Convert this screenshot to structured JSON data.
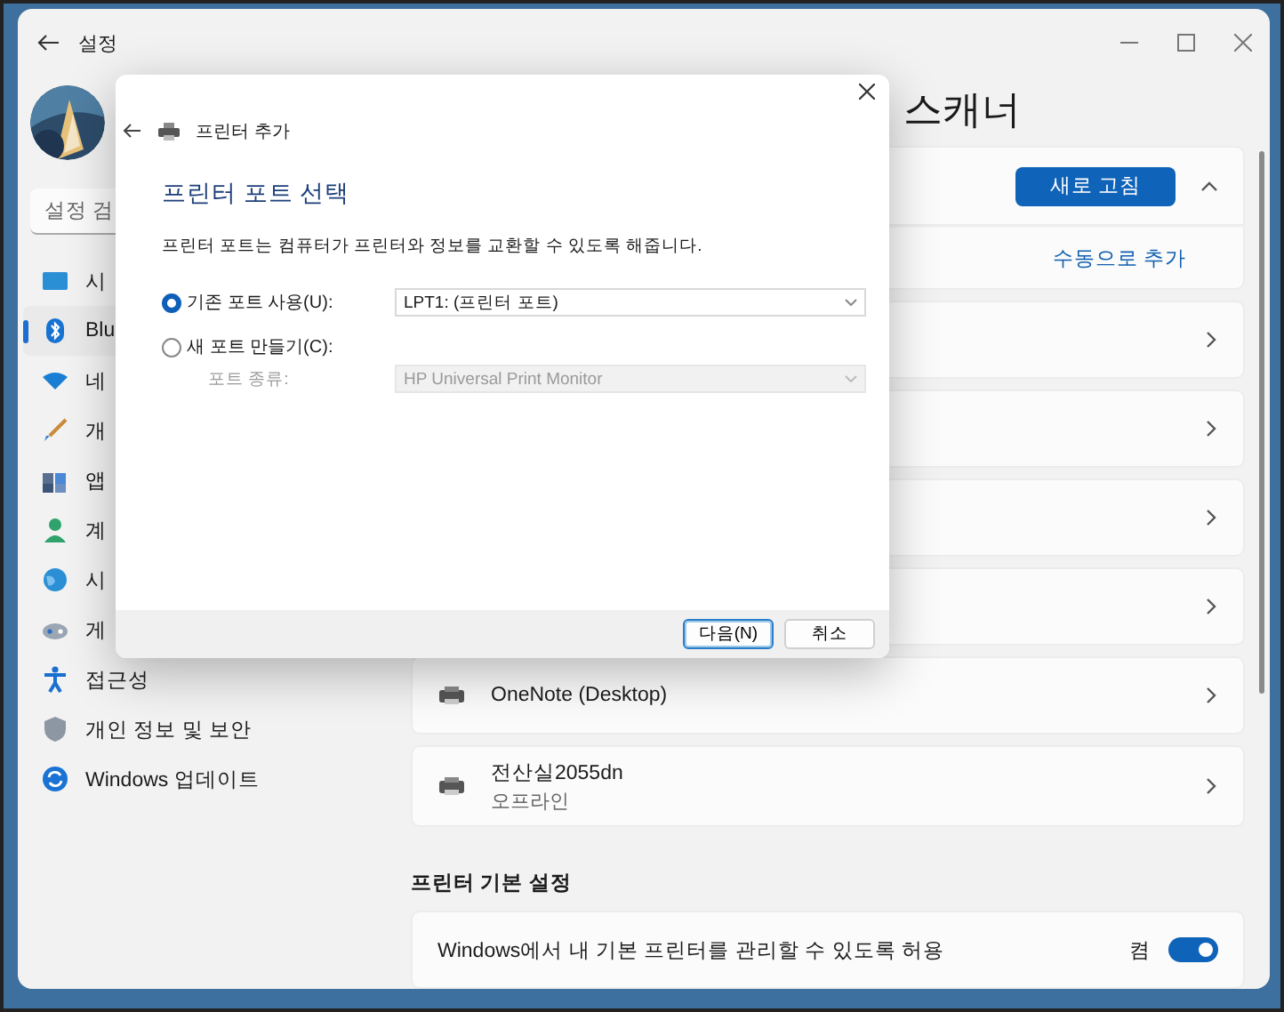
{
  "settings": {
    "title": "설정",
    "search": {
      "placeholder": "설정 검"
    },
    "sidebar": [
      {
        "label": "시",
        "selected": false
      },
      {
        "label": "Blu",
        "selected": true
      },
      {
        "label": "네",
        "selected": false
      },
      {
        "label": "개",
        "selected": false
      },
      {
        "label": "앱",
        "selected": false
      },
      {
        "label": "계",
        "selected": false
      },
      {
        "label": "시",
        "selected": false
      },
      {
        "label": "게",
        "selected": false
      },
      {
        "label": "접근성",
        "selected": false
      },
      {
        "label": "개인 정보 및 보안",
        "selected": false
      },
      {
        "label": "Windows 업데이트",
        "selected": false
      }
    ]
  },
  "page": {
    "title": "스캐너",
    "refresh_button": "새로 고침",
    "expanded": true,
    "add_link": "수동으로 추가",
    "devices": [
      {
        "kind": "covered"
      },
      {
        "kind": "covered"
      },
      {
        "kind": "covered"
      },
      {
        "kind": "covered"
      },
      {
        "kind": "printer",
        "name": "OneNote (Desktop)"
      },
      {
        "kind": "printer",
        "name": "전산실2055dn",
        "status": "오프라인"
      }
    ],
    "preferences_heading": "프린터 기본 설정",
    "preferences": [
      {
        "label": "Windows에서 내 기본 프린터를 관리할 수 있도록 허용",
        "state_text": "켬",
        "on": true
      }
    ]
  },
  "dialog": {
    "title": "프린터 추가",
    "heading": "프린터 포트 선택",
    "description": "프린터 포트는 컴퓨터가 프린터와 정보를 교환할 수 있도록 해줍니다.",
    "options": [
      {
        "label": "기존 포트 사용(U):",
        "selected": true,
        "value": "LPT1: (프린터 포트)"
      },
      {
        "label": "새 포트 만들기(C):",
        "selected": false
      }
    ],
    "port_type": {
      "label": "포트 종류:",
      "value": "HP Universal Print Monitor",
      "disabled": true
    },
    "buttons": [
      {
        "label": "다음(N)",
        "default": true
      },
      {
        "label": "취소",
        "default": false
      }
    ]
  }
}
